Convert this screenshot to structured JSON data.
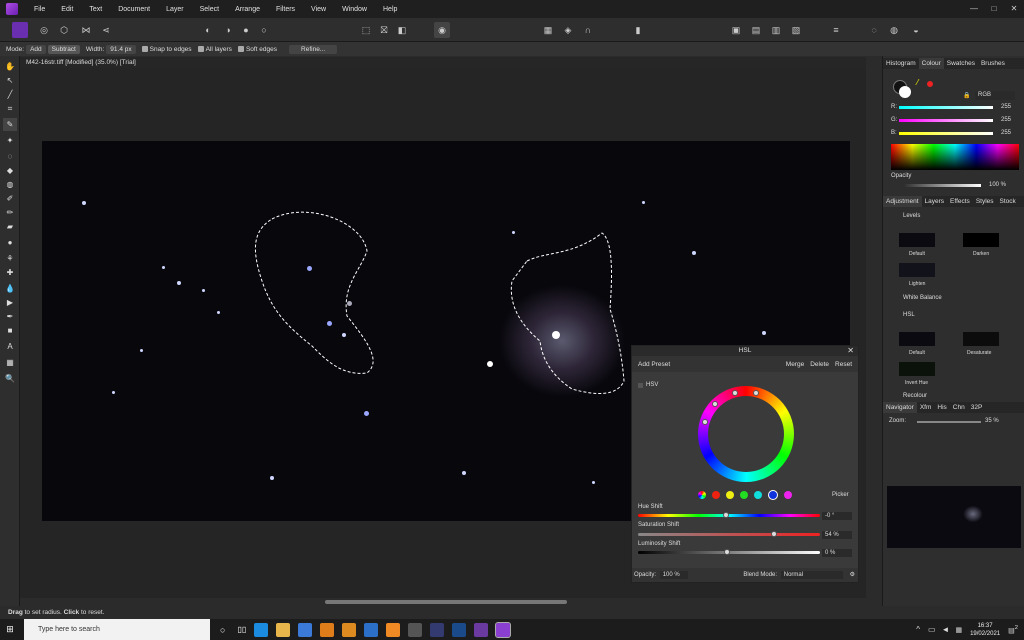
{
  "menu": {
    "items": [
      "File",
      "Edit",
      "Text",
      "Document",
      "Layer",
      "Select",
      "Arrange",
      "Filters",
      "View",
      "Window",
      "Help"
    ]
  },
  "window_controls": {
    "minimize": "—",
    "maximize": "□",
    "close": "✕"
  },
  "context_bar": {
    "mode_label": "Mode:",
    "mode_add": "Add",
    "mode_subtract": "Subtract",
    "width_label": "Width:",
    "width_value": "91.4 px",
    "snap": "Snap to edges",
    "all_layers": "All layers",
    "soft_edges": "Soft edges",
    "refine": "Refine..."
  },
  "document": {
    "tab": "M42-16str.tiff [Modified] (35.0%) [Trial]"
  },
  "hsl_panel": {
    "title": "HSL",
    "add_preset": "Add Preset",
    "merge": "Merge",
    "delete": "Delete",
    "reset": "Reset",
    "hsv_label": "HSV",
    "picker": "Picker",
    "hue_shift_label": "Hue Shift",
    "hue_shift_value": "-0 °",
    "saturation_shift_label": "Saturation Shift",
    "saturation_shift_value": "54 %",
    "luminosity_shift_label": "Luminosity Shift",
    "luminosity_shift_value": "0 %",
    "opacity_label": "Opacity:",
    "opacity_value": "100 %",
    "blend_label": "Blend Mode:",
    "blend_value": "Normal"
  },
  "right_panel": {
    "top_tabs": [
      "Histogram",
      "Colour",
      "Swatches",
      "Brushes"
    ],
    "color_mode": "RGB",
    "r_label": "R:",
    "r_value": "255",
    "g_label": "G:",
    "g_value": "255",
    "b_label": "B:",
    "b_value": "255",
    "opacity_label": "Opacity",
    "opacity_value": "100 %",
    "mid_tabs": [
      "Adjustment",
      "Layers",
      "Effects",
      "Styles",
      "Stock"
    ],
    "adjustments": {
      "levels": "Levels",
      "default": "Default",
      "darken": "Darken",
      "lighten": "Lighten",
      "white_balance": "White Balance",
      "hsl": "HSL",
      "default2": "Default",
      "desaturate": "Desaturate",
      "invert_hue": "Invert Hue",
      "recolour": "Recolour"
    },
    "bottom_tabs": [
      "Navigator",
      "Xfm",
      "His",
      "Chn",
      "32P"
    ],
    "zoom_label": "Zoom:",
    "zoom_value": "35 %"
  },
  "status": {
    "drag": "Drag",
    "text1": " to set radius. ",
    "click": "Click",
    "text2": " to reset."
  },
  "taskbar": {
    "search": "Type here to search",
    "time": "16:37",
    "date": "19/02/2021",
    "notif": "2"
  }
}
